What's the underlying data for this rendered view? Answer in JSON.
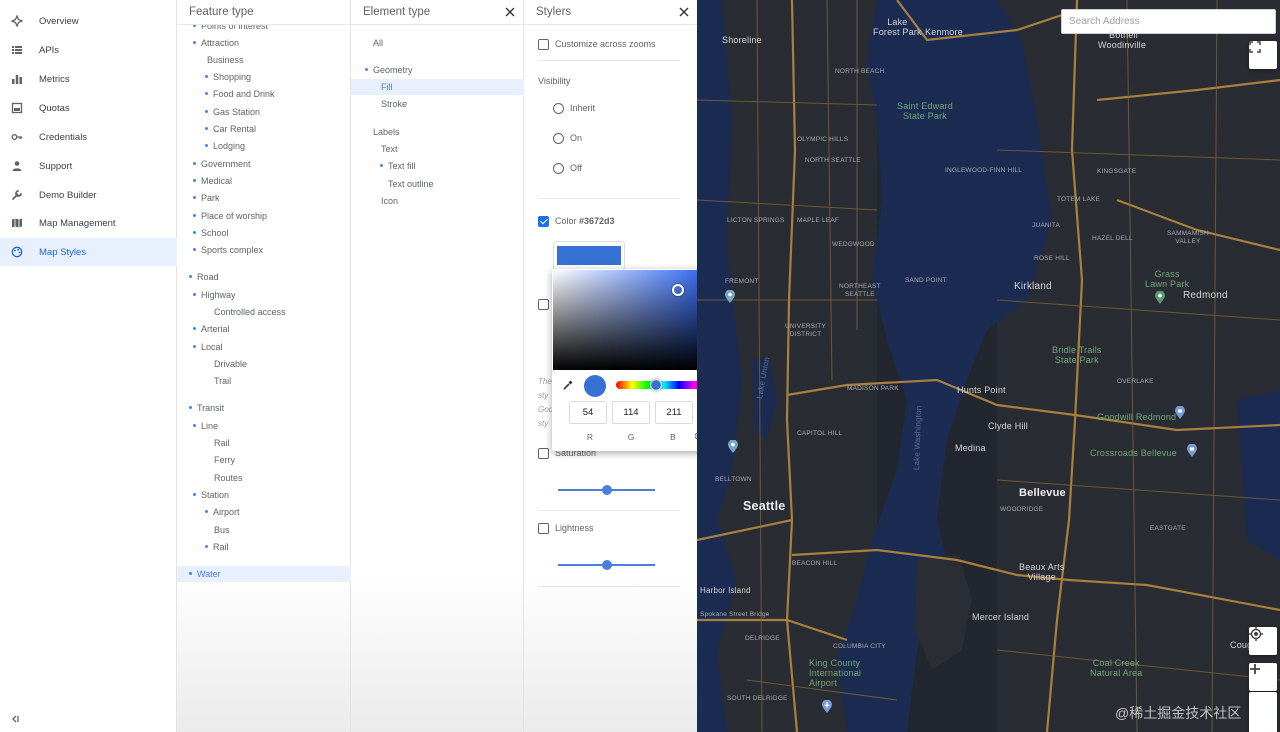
{
  "nav": {
    "items": [
      {
        "label": "Overview",
        "icon": "overview-icon"
      },
      {
        "label": "APIs",
        "icon": "apis-icon"
      },
      {
        "label": "Metrics",
        "icon": "metrics-icon"
      },
      {
        "label": "Quotas",
        "icon": "quotas-icon"
      },
      {
        "label": "Credentials",
        "icon": "key-icon"
      },
      {
        "label": "Support",
        "icon": "person-icon"
      },
      {
        "label": "Demo Builder",
        "icon": "wrench-icon"
      },
      {
        "label": "Map Management",
        "icon": "map-icon"
      },
      {
        "label": "Map Styles",
        "icon": "palette-icon",
        "active": true
      }
    ]
  },
  "feature_panel": {
    "title": "Feature type",
    "items": [
      {
        "label": "Points of interest",
        "dot": true
      },
      {
        "label": "Attraction",
        "dot": true
      },
      {
        "label": "Business",
        "dot": false
      },
      {
        "label": "Shopping",
        "dot": true
      },
      {
        "label": "Food and Drink",
        "dot": true
      },
      {
        "label": "Gas Station",
        "dot": true
      },
      {
        "label": "Car Rental",
        "dot": true
      },
      {
        "label": "Lodging",
        "dot": true
      },
      {
        "label": "Government",
        "dot": true
      },
      {
        "label": "Medical",
        "dot": true
      },
      {
        "label": "Park",
        "dot": true
      },
      {
        "label": "Place of worship",
        "dot": true
      },
      {
        "label": "School",
        "dot": true
      },
      {
        "label": "Sports complex",
        "dot": true
      },
      {
        "label": "Road",
        "dot": true
      },
      {
        "label": "Highway",
        "dot": true
      },
      {
        "label": "Controlled access",
        "dot": false
      },
      {
        "label": "Arterial",
        "dot": true
      },
      {
        "label": "Local",
        "dot": true
      },
      {
        "label": "Drivable",
        "dot": false
      },
      {
        "label": "Trail",
        "dot": false
      },
      {
        "label": "Transit",
        "dot": true
      },
      {
        "label": "Line",
        "dot": true
      },
      {
        "label": "Rail",
        "dot": false
      },
      {
        "label": "Ferry",
        "dot": false
      },
      {
        "label": "Routes",
        "dot": false
      },
      {
        "label": "Station",
        "dot": true
      },
      {
        "label": "Airport",
        "dot": true
      },
      {
        "label": "Bus",
        "dot": false
      },
      {
        "label": "Rail",
        "dot": true
      },
      {
        "label": "Water",
        "dot": true,
        "selected": true
      }
    ]
  },
  "element_panel": {
    "title": "Element type",
    "items": [
      {
        "label": "All",
        "dot": false
      },
      {
        "label": "Geometry",
        "dot": true
      },
      {
        "label": "Fill",
        "dot": false,
        "selected": true
      },
      {
        "label": "Stroke",
        "dot": false
      },
      {
        "label": "Labels",
        "dot": false
      },
      {
        "label": "Text",
        "dot": false
      },
      {
        "label": "Text fill",
        "dot": true
      },
      {
        "label": "Text outline",
        "dot": false
      },
      {
        "label": "Icon",
        "dot": false
      }
    ]
  },
  "styler_panel": {
    "title": "Stylers",
    "customize_label": "Customize across zooms",
    "visibility_label": "Visibility",
    "visibility_options": [
      "Inherit",
      "On",
      "Off"
    ],
    "color_label_prefix": "Color ",
    "color_value": "#3672d3",
    "desc_lines": [
      "The",
      "sty",
      "Goo",
      "sty"
    ],
    "saturation_label": "Saturation",
    "saturation_level": 0.5,
    "lightness_label": "Lightness",
    "lightness_level": 0.5
  },
  "color_picker": {
    "color": "#3672d3",
    "r": "54",
    "g": "114",
    "b": "211",
    "r_label": "R",
    "g_label": "G",
    "b_label": "B"
  },
  "map": {
    "search_placeholder": "Search Address",
    "labels": {
      "lake_forest_park": "Lake\nForest Park",
      "kenmore": "Kenmore",
      "shoreline": "Shoreline",
      "bothell": "Bothell",
      "woodinville": "Woodinville",
      "north_beach": "NORTH BEACH",
      "saint_edward": "Saint Edward\nState Park",
      "olympic_hills": "OLYMPIC HILLS",
      "north_seattle": "NORTH SEATTLE",
      "inglewood": "INGLEWOOD-FINN HILL",
      "kingsgate": "KINGSGATE",
      "totem_lake": "TOTEM LAKE",
      "licton_springs": "LICTON SPRINGS",
      "maple_leaf": "MAPLE LEAF",
      "juanita": "JUANITA",
      "sammamish_valley": "SAMMAMISH\nVALLEY",
      "hazel_dell": "HAZEL DELL",
      "wedgwood": "WEDGWOOD",
      "rose_hill": "ROSE HILL",
      "kirkland": "Kirkland",
      "grass_lawn": "Grass\nLawn Park",
      "redmond": "Redmond",
      "fremont": "FREMONT",
      "northeast_seattle": "NORTHEAST\nSEATTLE",
      "sand_point": "SAND POINT",
      "university_district": "UNIVERSITY\nDISTRICT",
      "bridle_trails": "Bridle Trails\nState Park",
      "hunts_point": "Hunts Point",
      "overlake": "OVERLAKE",
      "lake_union": "Lake Union",
      "madison_park": "MADISON PARK",
      "lake_washington": "Lake Washington",
      "clyde_hill": "Clyde Hill",
      "goodwill": "Goodwill Redmond",
      "crossroads": "Crossroads Bellevue",
      "capitol_hill": "CAPITOL HILL",
      "medina": "Medina",
      "belltown": "BELLTOWN",
      "bellevue": "Bellevue",
      "seattle": "Seattle",
      "woodridge": "WOODRIDGE",
      "eastgate": "EASTGATE",
      "beacon_hill": "BEACON HILL",
      "beaux_arts": "Beaux Arts\nVillage",
      "harbor_island": "Harbor Island",
      "spokane_bridge": "Spokane Street Bridge",
      "mercer_island": "Mercer Island",
      "delridge": "DELRIDGE",
      "columbia_city": "COLUMBIA CITY",
      "king_county": "King County\nInternational\nAirport",
      "coal_creek": "Coal Creek\nNatural Area",
      "cougar": "Cougar",
      "south_delridge": "SOUTH DELRIDGE"
    },
    "watermark": "@稀土掘金技术社区"
  }
}
